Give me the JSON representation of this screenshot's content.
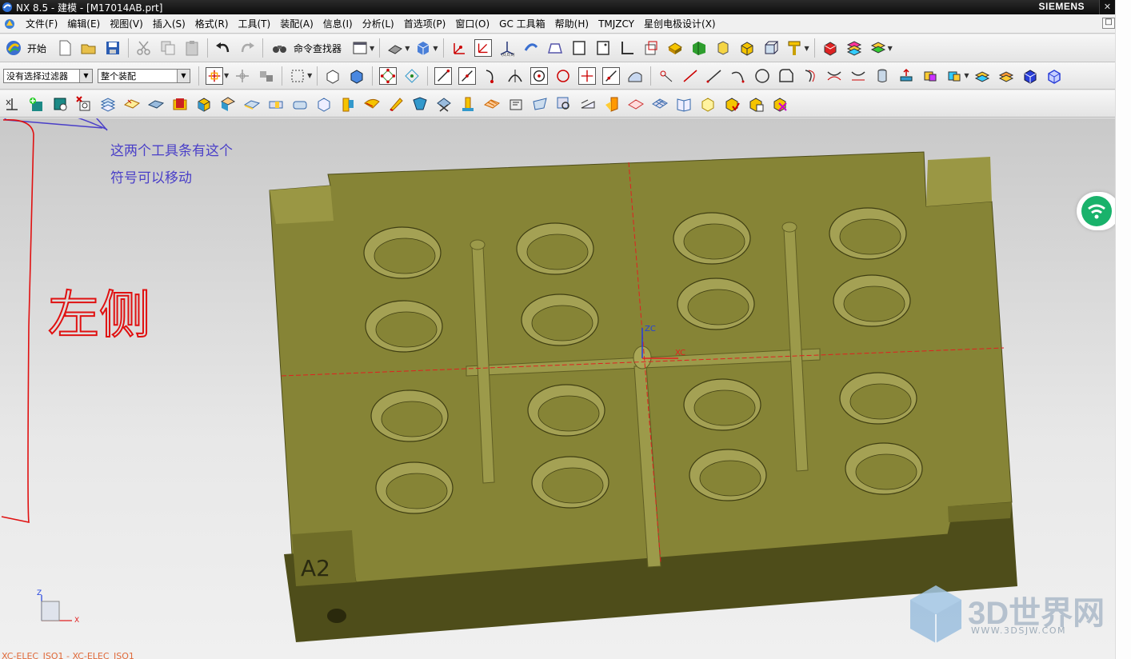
{
  "window": {
    "title": "NX 8.5 - 建模 - [M17014AB.prt]",
    "brand": "SIEMENS",
    "close_label": "✕",
    "restore_label": "□"
  },
  "menubar": {
    "items": [
      "文件(F)",
      "编辑(E)",
      "视图(V)",
      "插入(S)",
      "格式(R)",
      "工具(T)",
      "装配(A)",
      "信息(I)",
      "分析(L)",
      "首选项(P)",
      "窗口(O)",
      "GC 工具箱",
      "帮助(H)",
      "TMJZCY",
      "星创电极设计(X)"
    ]
  },
  "toolbar1": {
    "start_label": "开始",
    "command_finder_label": "命令查找器"
  },
  "toolbar2": {
    "selection_filter": "没有选择过滤器",
    "selection_scope": "整个装配"
  },
  "viewport": {
    "annotation_lines": [
      "这两个工具条有这个",
      "符号可以移动"
    ],
    "handwritten_note": "左侧",
    "part_label": "A2",
    "axis_labels": {
      "zc": "ZC",
      "xc": "XC",
      "triad_x": "X",
      "triad_z": "Z"
    },
    "view_label": "XC-ELEC_ISO1 - XC-ELEC_ISO1"
  },
  "watermark": {
    "brand": "3D世界网",
    "url": "WWW.3DSJW.COM"
  },
  "colors": {
    "mold_top": "#868436",
    "mold_side": "#4e4d1a",
    "annotation_blue": "#4a3fc8",
    "annotation_red": "#e01010"
  }
}
